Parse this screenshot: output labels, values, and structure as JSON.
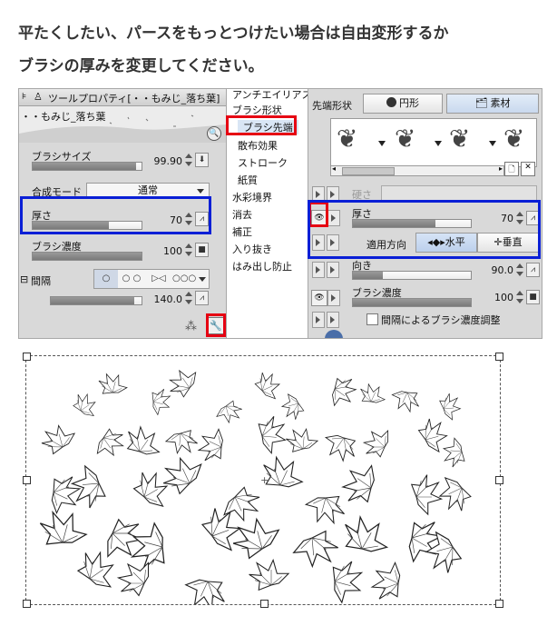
{
  "intro": {
    "line1": "平たくしたい、パースをもっとつけたい場合は自由変形するか",
    "line2": "ブラシの厚みを変更してください。"
  },
  "left_panel": {
    "title": "ツールプロパティ[・・もみじ_落ち葉]",
    "preset_name": "・・もみじ_落ち葉",
    "brush_size": {
      "label": "ブラシサイズ",
      "value": "99.90",
      "fill": 0.95
    },
    "blend_mode": {
      "label": "合成モード",
      "value": "通常"
    },
    "thickness": {
      "label": "厚さ",
      "value": "70",
      "fill": 0.7
    },
    "density": {
      "label": "ブラシ濃度",
      "value": "100",
      "fill": 1.0
    },
    "spacing": {
      "label": "間隔",
      "value": "140.0",
      "fill": 0.92,
      "options": [
        "○",
        "○ ○",
        "▷◁",
        "○○○"
      ]
    }
  },
  "middle_list": {
    "items": [
      "アンチエイリアス",
      "ブラシ形状",
      "ブラシ先端",
      "散布効果",
      "ストローク",
      "紙質",
      "水彩境界",
      "消去",
      "補正",
      "入り抜き",
      "はみ出し防止"
    ],
    "selected": "ブラシ先端"
  },
  "right_panel": {
    "tip_shape_label": "先端形状",
    "circle_button": "円形",
    "material_button": "素材",
    "hardness_label": "硬さ",
    "thickness": {
      "label": "厚さ",
      "value": "70",
      "fill": 0.7
    },
    "apply_direction": {
      "label": "適用方向",
      "horizontal": "水平",
      "vertical": "垂直"
    },
    "direction": {
      "label": "向き",
      "value": "90.0",
      "fill": 0.25
    },
    "density": {
      "label": "ブラシ濃度",
      "value": "100",
      "fill": 1.0
    },
    "spacing_density": "間隔によるブラシ濃度調整"
  },
  "colors": {
    "highlight_red": "#e60012",
    "highlight_blue": "#0a1fd6"
  }
}
